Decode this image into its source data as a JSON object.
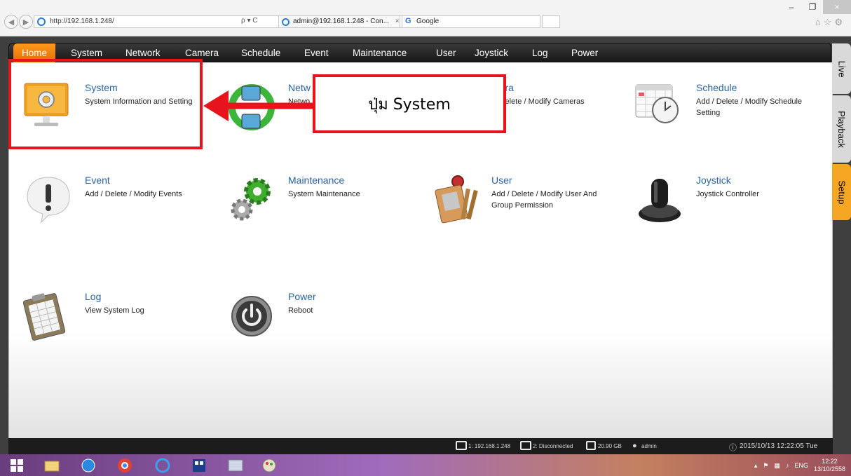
{
  "browser": {
    "url": "http://192.168.1.248/",
    "search_tools": "ρ ▾ C",
    "tabs": [
      {
        "label": "admin@192.168.1.248 - Con...",
        "close": "×"
      },
      {
        "label": "Google"
      }
    ],
    "chrome_icons": "⌂☆⚙",
    "window_controls": {
      "minimize": "–",
      "maximize": "❐",
      "close": "×"
    }
  },
  "nav": {
    "items": [
      "Home",
      "System",
      "Network",
      "Camera",
      "Schedule",
      "Event",
      "Maintenance",
      "User",
      "Joystick",
      "Log",
      "Power"
    ],
    "active": "Home"
  },
  "tiles": [
    {
      "title": "System",
      "desc": "System Information and Setting",
      "icon": "monitor-gear-icon"
    },
    {
      "title": "Netw",
      "desc": "Netwo",
      "icon": "network-icon"
    },
    {
      "title": "mera",
      "desc": "l / Delete / Modify Cameras\ning",
      "icon": "camera-icon"
    },
    {
      "title": "Schedule",
      "desc": "Add / Delete / Modify Schedule\nSetting",
      "icon": "calendar-clock-icon"
    },
    {
      "title": "Event",
      "desc": "Add / Delete / Modify Events",
      "icon": "exclamation-icon"
    },
    {
      "title": "Maintenance",
      "desc": "System Maintenance",
      "icon": "gears-icon"
    },
    {
      "title": "User",
      "desc": "Add / Delete / Modify User And\nGroup Permission",
      "icon": "id-card-keys-icon"
    },
    {
      "title": "Joystick",
      "desc": "Joystick Controller",
      "icon": "joystick-icon"
    },
    {
      "title": "Log",
      "desc": "View System Log",
      "icon": "clipboard-icon"
    },
    {
      "title": "Power",
      "desc": "Reboot",
      "icon": "power-icon"
    }
  ],
  "side_tabs": [
    {
      "label": "Live",
      "color": "#d9d9d9"
    },
    {
      "label": "Playback",
      "color": "#d9d9d9"
    },
    {
      "label": "Setup",
      "color": "#f5a623"
    }
  ],
  "status": {
    "ch1": "1: 192.168.1.248",
    "ch2": "2: Disconnected",
    "disk": "20.90 GB",
    "user": "admin",
    "datetime": "2015/10/13 12:22:05 Tue"
  },
  "annotation": {
    "label": "ปุ่ม System"
  },
  "taskbar": {
    "lang": "ENG",
    "time": "12:22",
    "date": "13/10/2558"
  },
  "colors": {
    "accent": "#f08a0c",
    "annotation": "#e8141b",
    "tile_title": "#2b63a3"
  }
}
